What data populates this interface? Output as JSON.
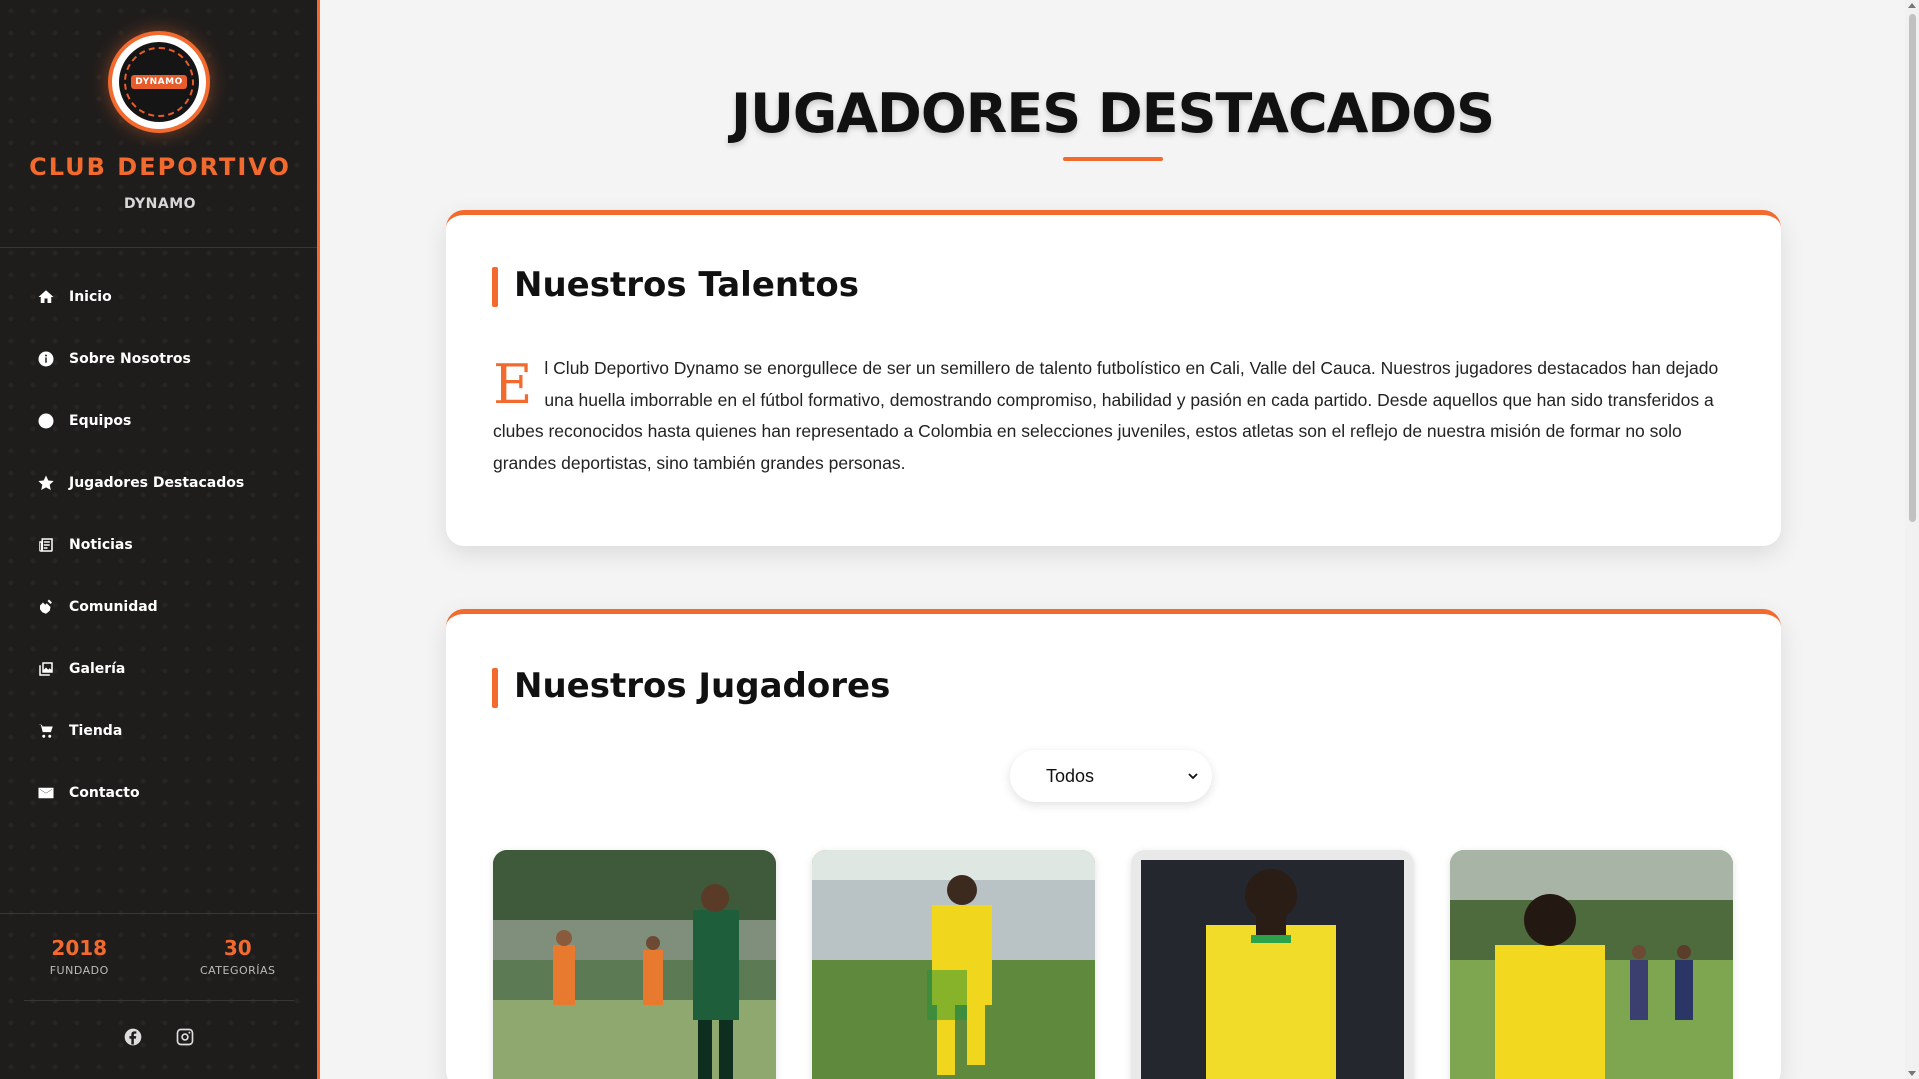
{
  "brand": {
    "logo_text": "DYNAMO",
    "title": "CLUB DEPORTIVO",
    "subtitle": "DYNAMO"
  },
  "nav": [
    {
      "label": "Inicio",
      "icon": "home-icon"
    },
    {
      "label": "Sobre Nosotros",
      "icon": "info-icon"
    },
    {
      "label": "Equipos",
      "icon": "circle-icon"
    },
    {
      "label": "Jugadores Destacados",
      "icon": "star-icon"
    },
    {
      "label": "Noticias",
      "icon": "newspaper-icon"
    },
    {
      "label": "Comunidad",
      "icon": "hands-icon"
    },
    {
      "label": "Galería",
      "icon": "gallery-icon"
    },
    {
      "label": "Tienda",
      "icon": "cart-icon"
    },
    {
      "label": "Contacto",
      "icon": "envelope-icon"
    }
  ],
  "stats": [
    {
      "value": "2018",
      "label": "FUNDADO"
    },
    {
      "value": "30",
      "label": "CATEGORÍAS"
    }
  ],
  "social": [
    "facebook-icon",
    "instagram-icon"
  ],
  "page_title": "JUGADORES DESTACADOS",
  "talents": {
    "heading": "Nuestros Talentos",
    "dropcap": "E",
    "text": "l Club Deportivo Dynamo se enorgullece de ser un semillero de talento futbolístico en Cali, Valle del Cauca. Nuestros jugadores destacados han dejado una huella imborrable en el fútbol formativo, demostrando compromiso, habilidad y pasión en cada partido. Desde aquellos que han sido transferidos a clubes reconocidos hasta quienes han representado a Colombia en selecciones juveniles, estos atletas son el reflejo de nuestra misión de formar no solo grandes deportistas, sino también grandes personas."
  },
  "players_section": {
    "heading": "Nuestros Jugadores",
    "filter_value": "Todos"
  },
  "colors": {
    "accent": "#f26a2e",
    "sidebar_bg": "#1f1d1c"
  }
}
